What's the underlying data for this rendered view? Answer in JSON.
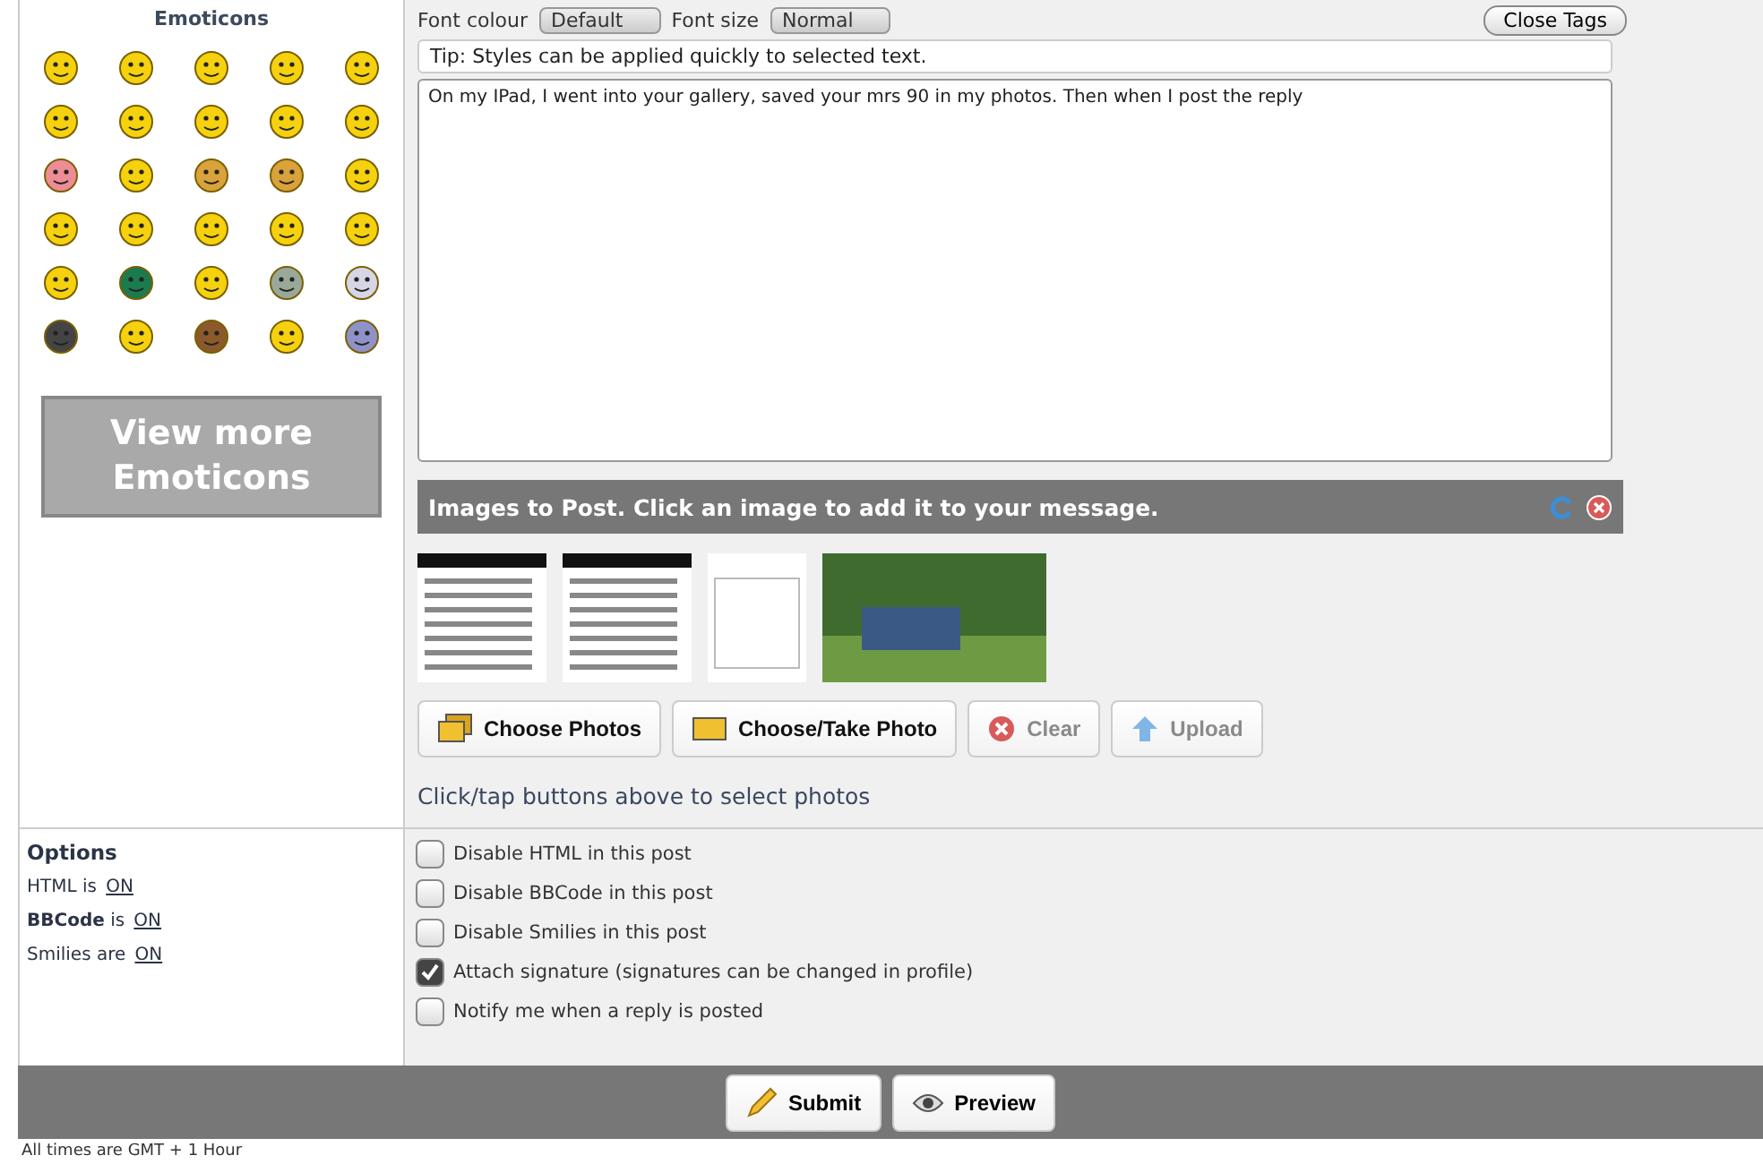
{
  "toolbar": {
    "font_colour": {
      "label": "Font colour",
      "value": "Default"
    },
    "font_size": {
      "label": "Font size",
      "value": "Normal"
    },
    "close_tags": "Close Tags"
  },
  "emoticons": {
    "title": "Emoticons",
    "view_more": "View more Emoticons"
  },
  "tip": "Tip: Styles can be applied quickly to selected text.",
  "message": "On my IPad, I went into your gallery, saved your mrs 90 in my photos. Then when I post the reply",
  "images_panel": {
    "title": "Images to Post. Click an image to add it to your message.",
    "thumbnails": [
      {
        "kind": "document"
      },
      {
        "kind": "document"
      },
      {
        "kind": "form"
      },
      {
        "kind": "photo"
      }
    ],
    "buttons": [
      {
        "label": "Choose Photos",
        "kind": "photos",
        "disabled": false
      },
      {
        "label": "Choose/Take Photo",
        "kind": "photo",
        "disabled": false
      },
      {
        "label": "Clear",
        "kind": "clear",
        "disabled": true
      },
      {
        "label": "Upload",
        "kind": "upload",
        "disabled": true
      }
    ],
    "hint": "Click/tap buttons above to select photos"
  },
  "options": {
    "title": "Options",
    "settings": [
      {
        "label": "HTML is",
        "value": "ON"
      },
      {
        "label": "**BBCode** is",
        "value": "ON"
      },
      {
        "label": "Smilies are",
        "value": "ON"
      }
    ],
    "checkboxes": [
      {
        "label": "Disable HTML in this post",
        "checked": false
      },
      {
        "label": "Disable BBCode in this post",
        "checked": false
      },
      {
        "label": "Disable Smilies in this post",
        "checked": false
      },
      {
        "label": "Attach signature (signatures can be changed in profile)",
        "checked": true
      },
      {
        "label": "Notify me when a reply is posted",
        "checked": false
      }
    ]
  },
  "actions": [
    {
      "label": "Submit",
      "kind": "pencil"
    },
    {
      "label": "Preview",
      "kind": "eye"
    }
  ],
  "footer": "All times are GMT + 1 Hour"
}
